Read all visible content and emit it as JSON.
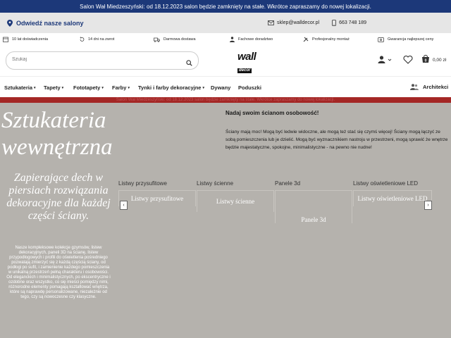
{
  "top_notice": "Salon Wał Miedzeszyński: od 18.12.2023 salon będzie zamknięty na stałe. Wkrótce zapraszamy do nowej lokalizacji.",
  "showrooms": {
    "label": "Odwiedź nasze salony",
    "email": "sklep@walldecor.pl",
    "phone": "663 748 189"
  },
  "features": [
    "10 lat doświadczenia",
    "14 dni na zwrot",
    "Darmowa dostawa",
    "Fachowe doradztwo",
    "Profesjonalny montaż",
    "Gwarancja najlepszej ceny"
  ],
  "search": {
    "placeholder": "Szukaj"
  },
  "logo": {
    "top": "wall",
    "bottom": "decor"
  },
  "cart": {
    "total": "0,00 zł"
  },
  "nav": {
    "items": [
      "Sztukateria",
      "Tapety",
      "Fototapety",
      "Farby",
      "Tynki i farby dekoracyjne",
      "Dywany",
      "Poduszki"
    ],
    "architects": "Architekci"
  },
  "red_notice": "Salon Wał Miedzeszyński: od 18.12.2023 salon będzie zamknięty na stałe. Wkrótce zapraszamy do nowej lokalizacji.",
  "hero": {
    "title_line1": "Sztukateria",
    "title_line2": "wewnętrzna",
    "subtitle": "Zapierające dech w piersiach rozwiązania dekoracyjne dla każdej części ściany.",
    "description": "Nasze kompleksowe kolekcje gzymsów, listew dekoracyjnych, paneli 3D na ścianę, listew przypodłogowych i profili do oświetlenia pośredniego pozwalają zmierzyć się z każdą częścią ściany, od podłogi po sufit, i zamienienie każdego pomieszczenia w unikalną przestrzeń pełną charakteru i osobowości. Od eleganckich i minimalistycznych, po ekscentryczne i ozdobne oraz wszystko, co się mieści pomiędzy nimi, różnorodne elementy pomagają kształtować wnętrza, które są naprawdę personalizowane, niezależnie od tego, czy są nowoczesne czy klasyczne.",
    "right_title": "Nadaj swoim ścianom osobowość!",
    "right_text": "Ściany mają moc! Mogą być ledwie widoczne, ale mogą też stać się czymś więcej! Ściany mogą łączyć ze sobą pomieszczenia lub je dzielić. Mogą być wyznacznikiem nastroju w przestrzeni, mogą sprawić że wnętrze będzie majestatyczne, spokojne, minimalistyczne - na pewno nie nudne!"
  },
  "cards": [
    {
      "title": "Listwy przysufitowe",
      "img_alt": "Listwy przysufitowe"
    },
    {
      "title": "Listwy ścienne",
      "img_alt": "Listwy ścienne"
    },
    {
      "title": "Panele 3d",
      "img_alt": "Panele 3d"
    },
    {
      "title": "Listwy oświetleniowe LED",
      "img_alt": "Listwy oświetleniowe LED"
    }
  ],
  "colors": {
    "topbar": "#1c3879",
    "red_bar": "#a42725",
    "hero_bg": "#b5b2ad"
  }
}
